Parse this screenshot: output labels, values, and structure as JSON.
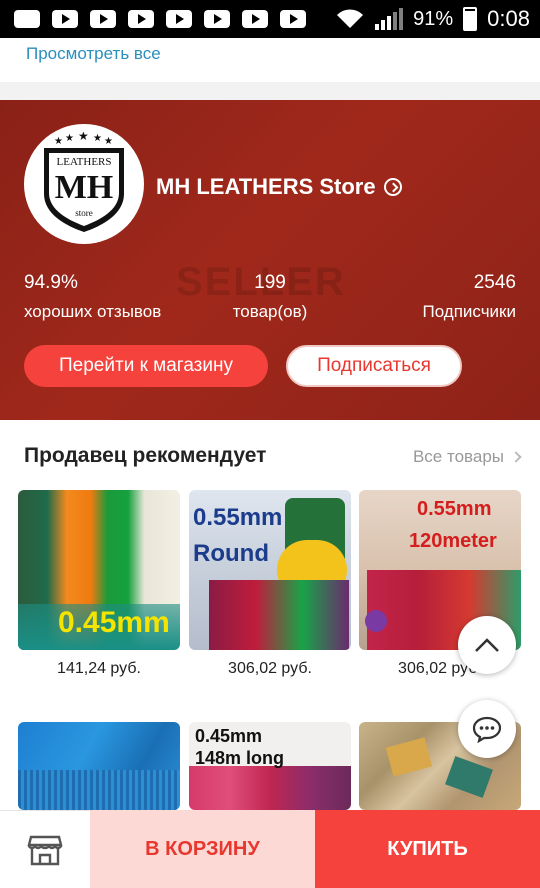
{
  "status_bar": {
    "battery": "91%",
    "time": "0:08"
  },
  "top": {
    "view_all": "Просмотреть все"
  },
  "store": {
    "name": "MH LEATHERS Store",
    "logo_text": {
      "top": "LEATHERS",
      "mono": "MH",
      "bottom": "store"
    },
    "stats": [
      {
        "value": "94.9%",
        "label": "хороших отзывов"
      },
      {
        "value": "199",
        "label": "товар(ов)"
      },
      {
        "value": "2546",
        "label": "Подписчики"
      }
    ],
    "go_button": "Перейти к магазину",
    "subscribe_button": "Подписаться"
  },
  "recommend": {
    "title": "Продавец рекомендует",
    "all_link": "Все товары",
    "products": [
      {
        "price": "141,24 руб.",
        "img_text": "0.45mm"
      },
      {
        "price": "306,02 руб.",
        "img_text": [
          "0.55mm",
          "Round"
        ]
      },
      {
        "price": "306,02 руб.",
        "img_text": [
          "0.55mm",
          "120meter"
        ]
      },
      {
        "price": "",
        "img_text": ""
      },
      {
        "price": "",
        "img_text": [
          "0.45mm",
          "148m long"
        ]
      },
      {
        "price": "",
        "img_text": ""
      }
    ]
  },
  "bottom_bar": {
    "cart_label": "В КОРЗИНУ",
    "buy_label": "КУПИТЬ"
  },
  "icons": [
    "play-icon",
    "wifi-icon",
    "signal-icon",
    "battery-icon",
    "arrow-right-circle-icon",
    "chevron-right-icon",
    "arrow-up-icon",
    "chat-icon",
    "store-icon"
  ],
  "colors": {
    "banner": "#8a2117",
    "accent": "#f5423c",
    "link": "#2a8fbd"
  }
}
